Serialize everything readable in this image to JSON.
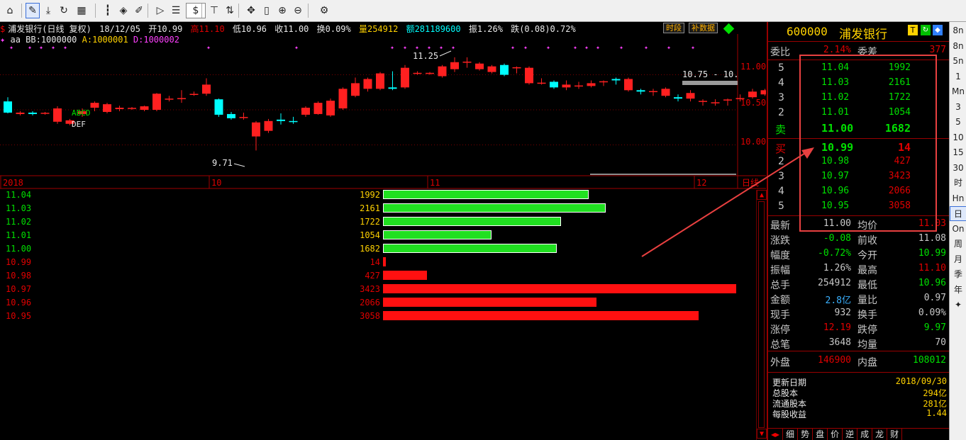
{
  "toolbar": {
    "buttons": [
      {
        "name": "home-icon",
        "glyph": "⌂"
      },
      {
        "name": "draw-pen-icon",
        "glyph": "✎"
      },
      {
        "name": "download-icon",
        "glyph": "⤓"
      },
      {
        "name": "refresh-icon",
        "glyph": "↻"
      },
      {
        "name": "grid-layout-icon",
        "glyph": "▦"
      },
      {
        "name": "candlestick-icon",
        "glyph": "┇"
      },
      {
        "name": "diamond-signal-icon",
        "glyph": "◈"
      },
      {
        "name": "edit-icon",
        "glyph": "✐"
      },
      {
        "name": "play-icon",
        "glyph": "▷"
      },
      {
        "name": "report-icon",
        "glyph": "☰"
      },
      {
        "name": "dollar-icon",
        "glyph": "$"
      },
      {
        "name": "filter-icon",
        "glyph": "⊤"
      },
      {
        "name": "sort-icon",
        "glyph": "⇅"
      },
      {
        "name": "move-icon",
        "glyph": "✥"
      },
      {
        "name": "column-icon",
        "glyph": "▯"
      },
      {
        "name": "zoom-in-icon",
        "glyph": "⊕"
      },
      {
        "name": "zoom-out-icon",
        "glyph": "⊖"
      },
      {
        "name": "settings-icon",
        "glyph": "⚙"
      }
    ]
  },
  "header": {
    "name": "浦发银行(日线 复权)",
    "date": "18/12/05",
    "open": "开10.99",
    "high": "高11.10",
    "low": "低10.96",
    "close": "收11.00",
    "turnover": "换0.09%",
    "volume": "量254912",
    "amount": "额281189600",
    "amplitude": "振1.26%",
    "change": "跌(0.08)0.72%",
    "btn_timeshare": "时段",
    "btn_supplement": "补数据"
  },
  "indicators": {
    "star": "✦",
    "aa": "aa",
    "bb": "BB:1000000",
    "a": "A:1000001",
    "d": "D:1000002"
  },
  "chart_data": {
    "type": "candlestick",
    "price_ticks": [
      "11.00",
      "10.50",
      "10.00"
    ],
    "date_ticks": [
      "2018",
      "10",
      "11",
      "12"
    ],
    "axis_end_label": "日线",
    "annotations": {
      "low": "9.71",
      "high": "11.25",
      "range": "10.75 - 10.",
      "abcd": "ABCD",
      "def": "DEF"
    },
    "ylim": [
      9.5,
      11.5
    ],
    "candles": [
      [
        10.62,
        10.46,
        10.68,
        10.45
      ],
      [
        10.44,
        10.46,
        10.48,
        10.42
      ],
      [
        10.46,
        10.44,
        10.48,
        10.42
      ],
      [
        10.45,
        10.45,
        10.47,
        10.43
      ],
      [
        10.33,
        10.52,
        10.55,
        10.3
      ],
      [
        10.3,
        10.35,
        10.37,
        10.28
      ],
      [
        10.44,
        10.48,
        10.52,
        10.4
      ],
      [
        10.53,
        10.6,
        10.62,
        10.48
      ],
      [
        10.47,
        10.58,
        10.6,
        10.45
      ],
      [
        10.51,
        10.53,
        10.56,
        10.48
      ],
      [
        10.52,
        10.52,
        10.54,
        10.5
      ],
      [
        10.5,
        10.55,
        10.56,
        10.48
      ],
      [
        10.5,
        10.73,
        10.74,
        10.48
      ],
      [
        10.65,
        10.66,
        10.7,
        10.62
      ],
      [
        10.66,
        10.66,
        10.78,
        10.6
      ],
      [
        10.72,
        10.72,
        10.76,
        10.7
      ],
      [
        10.73,
        10.86,
        10.95,
        10.7
      ],
      [
        10.65,
        10.43,
        10.66,
        10.4
      ],
      [
        10.44,
        10.38,
        10.47,
        10.36
      ],
      [
        10.39,
        10.39,
        10.46,
        10.36
      ],
      [
        10.12,
        10.32,
        10.34,
        9.92
      ],
      [
        10.2,
        10.34,
        10.37,
        10.17
      ],
      [
        10.36,
        10.34,
        10.45,
        10.29
      ],
      [
        10.34,
        10.33,
        10.4,
        10.3
      ],
      [
        10.43,
        10.53,
        10.55,
        10.4
      ],
      [
        10.44,
        10.6,
        10.62,
        10.43
      ],
      [
        10.42,
        10.63,
        10.66,
        10.4
      ],
      [
        10.52,
        10.8,
        10.82,
        10.5
      ],
      [
        10.7,
        10.88,
        10.96,
        10.68
      ],
      [
        10.8,
        10.94,
        10.96,
        10.76
      ],
      [
        10.8,
        11.02,
        11.04,
        10.78
      ],
      [
        10.82,
        10.8,
        11.05,
        10.78
      ],
      [
        10.82,
        11.1,
        11.14,
        10.8
      ],
      [
        11.02,
        11.02,
        11.05,
        11.0
      ],
      [
        11.02,
        11.02,
        11.04,
        11.0
      ],
      [
        10.98,
        11.12,
        11.14,
        10.96
      ],
      [
        11.08,
        11.18,
        11.25,
        11.04
      ],
      [
        11.18,
        11.18,
        11.25,
        11.1
      ],
      [
        11.08,
        11.16,
        11.18,
        11.06
      ],
      [
        11.04,
        11.12,
        11.14,
        11.02
      ],
      [
        11.14,
        11.0,
        11.16,
        10.98
      ],
      [
        11.1,
        11.1,
        11.12,
        11.02
      ],
      [
        10.88,
        11.1,
        11.12,
        10.86
      ],
      [
        10.88,
        10.88,
        10.95,
        10.86
      ],
      [
        10.9,
        10.82,
        10.92,
        10.8
      ],
      [
        10.82,
        10.86,
        10.92,
        10.78
      ],
      [
        10.84,
        10.84,
        10.9,
        10.8
      ],
      [
        10.84,
        10.88,
        10.92,
        10.82
      ],
      [
        10.9,
        10.9,
        10.92,
        10.84
      ],
      [
        10.94,
        10.92,
        10.96,
        10.86
      ],
      [
        10.78,
        10.94,
        10.96,
        10.76
      ],
      [
        10.78,
        10.76,
        10.8,
        10.72
      ],
      [
        10.76,
        10.76,
        10.8,
        10.7
      ],
      [
        10.7,
        10.8,
        10.82,
        10.68
      ],
      [
        10.68,
        10.66,
        10.72,
        10.62
      ],
      [
        10.66,
        10.74,
        10.78,
        10.62
      ],
      [
        10.62,
        10.62,
        10.65,
        10.56
      ],
      [
        10.6,
        10.6,
        10.65,
        10.56
      ],
      [
        10.64,
        10.64,
        10.66,
        10.56
      ],
      [
        10.66,
        10.66,
        10.72,
        10.62
      ],
      [
        10.68,
        10.76,
        10.8,
        10.66
      ],
      [
        10.72,
        10.78,
        10.8,
        10.7
      ],
      [
        10.96,
        11.0,
        11.02,
        10.94
      ],
      [
        11.02,
        11.08,
        11.1,
        11.0
      ],
      [
        11.04,
        11.04,
        11.1,
        10.98
      ]
    ],
    "stars": [
      0,
      1,
      2,
      3,
      4,
      5,
      6,
      7,
      8,
      9,
      10,
      11,
      12,
      13,
      14,
      15,
      16,
      17,
      18,
      19,
      20,
      21,
      22,
      23,
      24,
      25,
      26,
      27,
      28,
      29,
      30,
      31,
      32,
      33,
      34,
      35,
      36,
      37,
      38,
      39,
      40,
      41,
      42,
      43,
      44,
      45,
      46,
      47,
      48,
      49,
      50,
      51,
      52,
      53,
      54,
      55,
      56,
      57,
      58,
      59,
      60,
      61,
      62,
      63,
      64
    ]
  },
  "depth": {
    "rows": [
      {
        "price": "11.04",
        "vol": "1992",
        "side": "sell",
        "n": 1992
      },
      {
        "price": "11.03",
        "vol": "2161",
        "side": "sell",
        "n": 2161
      },
      {
        "price": "11.02",
        "vol": "1722",
        "side": "sell",
        "n": 1722
      },
      {
        "price": "11.01",
        "vol": "1054",
        "side": "sell",
        "n": 1054
      },
      {
        "price": "11.00",
        "vol": "1682",
        "side": "sell",
        "n": 1682
      },
      {
        "price": "10.99",
        "vol": "14",
        "side": "buy",
        "n": 14
      },
      {
        "price": "10.98",
        "vol": "427",
        "side": "buy",
        "n": 427
      },
      {
        "price": "10.97",
        "vol": "3423",
        "side": "buy",
        "n": 3423
      },
      {
        "price": "10.96",
        "vol": "2066",
        "side": "buy",
        "n": 2066
      },
      {
        "price": "10.95",
        "vol": "3058",
        "side": "buy",
        "n": 3058
      }
    ]
  },
  "quote": {
    "code": "600000",
    "name": "浦发银行",
    "badge_t": "T",
    "weibi_label": "委比",
    "weibi_value": "2.14%",
    "weicha_label": "委差",
    "weicha_value": "377",
    "sell_label": "卖",
    "buy_label": "买",
    "asks": [
      {
        "lvl": "5",
        "price": "11.04",
        "vol": "1992"
      },
      {
        "lvl": "4",
        "price": "11.03",
        "vol": "2161"
      },
      {
        "lvl": "3",
        "price": "11.02",
        "vol": "1722"
      },
      {
        "lvl": "2",
        "price": "11.01",
        "vol": "1054"
      },
      {
        "lvl": "",
        "price": "11.00",
        "vol": "1682"
      }
    ],
    "bids": [
      {
        "lvl": "",
        "price": "10.99",
        "vol": "14"
      },
      {
        "lvl": "2",
        "price": "10.98",
        "vol": "427"
      },
      {
        "lvl": "3",
        "price": "10.97",
        "vol": "3423"
      },
      {
        "lvl": "4",
        "price": "10.96",
        "vol": "2066"
      },
      {
        "lvl": "5",
        "price": "10.95",
        "vol": "3058"
      }
    ],
    "stats": [
      {
        "a": "最新",
        "b": "11.00",
        "bc": "#c8c8c8",
        "c": "均价",
        "d": "11.03",
        "dc": "#e00000"
      },
      {
        "a": "涨跌",
        "b": "-0.08",
        "bc": "#00e000",
        "c": "前收",
        "d": "11.08",
        "dc": "#c8c8c8"
      },
      {
        "a": "幅度",
        "b": "-0.72%",
        "bc": "#00e000",
        "c": "今开",
        "d": "10.99",
        "dc": "#00e000"
      },
      {
        "a": "振幅",
        "b": "1.26%",
        "bc": "#c8c8c8",
        "c": "最高",
        "d": "11.10",
        "dc": "#e00000"
      },
      {
        "a": "总手",
        "b": "254912",
        "bc": "#c8c8c8",
        "c": "最低",
        "d": "10.96",
        "dc": "#00e000"
      },
      {
        "a": "金额",
        "b": "2.8亿",
        "bc": "#3ab0ff",
        "c": "量比",
        "d": "0.97",
        "dc": "#c8c8c8"
      },
      {
        "a": "现手",
        "b": "932",
        "bc": "#c8c8c8",
        "c": "换手",
        "d": "0.09%",
        "dc": "#c8c8c8"
      },
      {
        "a": "涨停",
        "b": "12.19",
        "bc": "#e00000",
        "c": "跌停",
        "d": "9.97",
        "dc": "#00e000"
      },
      {
        "a": "总笔",
        "b": "3648",
        "bc": "#c8c8c8",
        "c": "均量",
        "d": "70",
        "dc": "#c8c8c8"
      }
    ],
    "waipan_label": "外盘",
    "waipan_value": "146900",
    "neipan_label": "内盘",
    "neipan_value": "108012",
    "info": [
      {
        "k": "更新日期",
        "v": "2018/09/30"
      },
      {
        "k": "总股本",
        "v": "294亿"
      },
      {
        "k": "流通股本",
        "v": "281亿"
      },
      {
        "k": "每股收益",
        "v": "1.44"
      }
    ]
  },
  "bottom_tabs": [
    "细",
    "势",
    "盘",
    "价",
    "逆",
    "成",
    "龙",
    "财"
  ],
  "periods": [
    "8n",
    "8n",
    "5n",
    "1",
    "Mn",
    "3",
    "5",
    "10",
    "15",
    "30",
    "时",
    "Hn",
    "日",
    "On",
    "周",
    "月",
    "季",
    "年",
    "✦"
  ],
  "period_selected": 12,
  "colors": {
    "up": "#ff2020",
    "down": "#00ffff",
    "green": "#00e000",
    "red": "#e00000",
    "yellow": "#ffd200",
    "magenta": "#ff40ff"
  }
}
